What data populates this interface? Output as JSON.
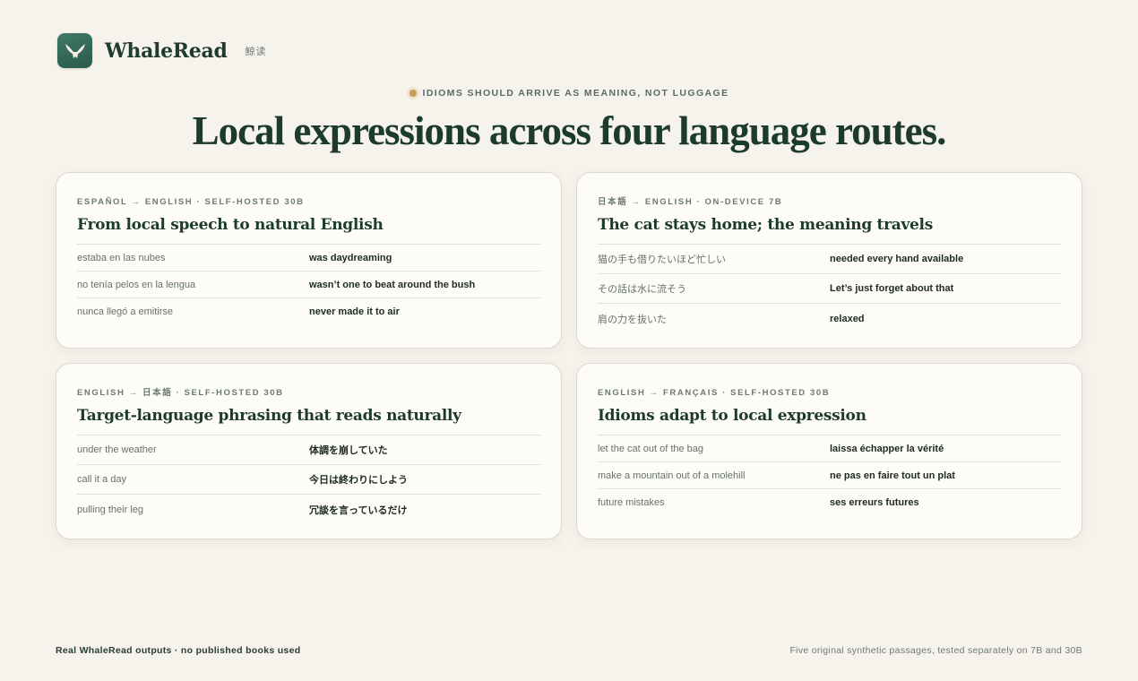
{
  "brand": {
    "name": "WhaleRead",
    "cjk": "鯨读"
  },
  "eyebrow": "IDIOMS SHOULD ARRIVE AS MEANING, NOT LUGGAGE",
  "headline": "Local expressions across four language routes.",
  "cards": [
    {
      "route": "ESPAÑOL → ENGLISH · SELF-HOSTED 30B",
      "title": "From local speech to natural English",
      "rows": [
        {
          "source": "estaba en las nubes",
          "target": "was daydreaming"
        },
        {
          "source": "no tenía pelos en la lengua",
          "target": "wasn’t one to beat around the bush"
        },
        {
          "source": "nunca llegó a emitirse",
          "target": "never made it to air"
        }
      ]
    },
    {
      "route": "日本語 → ENGLISH · ON-DEVICE 7B",
      "title": "The cat stays home; the meaning travels",
      "rows": [
        {
          "source": "猫の手も借りたいほど忙しい",
          "target": "needed every hand available"
        },
        {
          "source": "その話は水に流そう",
          "target": "Let’s just forget about that"
        },
        {
          "source": "肩の力を抜いた",
          "target": "relaxed"
        }
      ]
    },
    {
      "route": "ENGLISH → 日本語 · SELF-HOSTED 30B",
      "title": "Target-language phrasing that reads naturally",
      "rows": [
        {
          "source": "under the weather",
          "target": "体調を崩していた"
        },
        {
          "source": "call it a day",
          "target": "今日は終わりにしよう"
        },
        {
          "source": "pulling their leg",
          "target": "冗談を言っているだけ"
        }
      ]
    },
    {
      "route": "ENGLISH → FRANÇAIS · SELF-HOSTED 30B",
      "title": "Idioms adapt to local expression",
      "rows": [
        {
          "source": "let the cat out of the bag",
          "target": "laissa échapper la vérité"
        },
        {
          "source": "make a mountain out of a molehill",
          "target": "ne pas en faire tout un plat"
        },
        {
          "source": "future mistakes",
          "target": "ses erreurs futures"
        }
      ]
    }
  ],
  "footer": {
    "left": "Real WhaleRead outputs · no published books used",
    "right": "Five original synthetic passages, tested separately on 7B and 30B"
  },
  "colors": {
    "background": "#f6f3ec",
    "accent": "#2f6a59",
    "dot": "#c99a5a"
  }
}
